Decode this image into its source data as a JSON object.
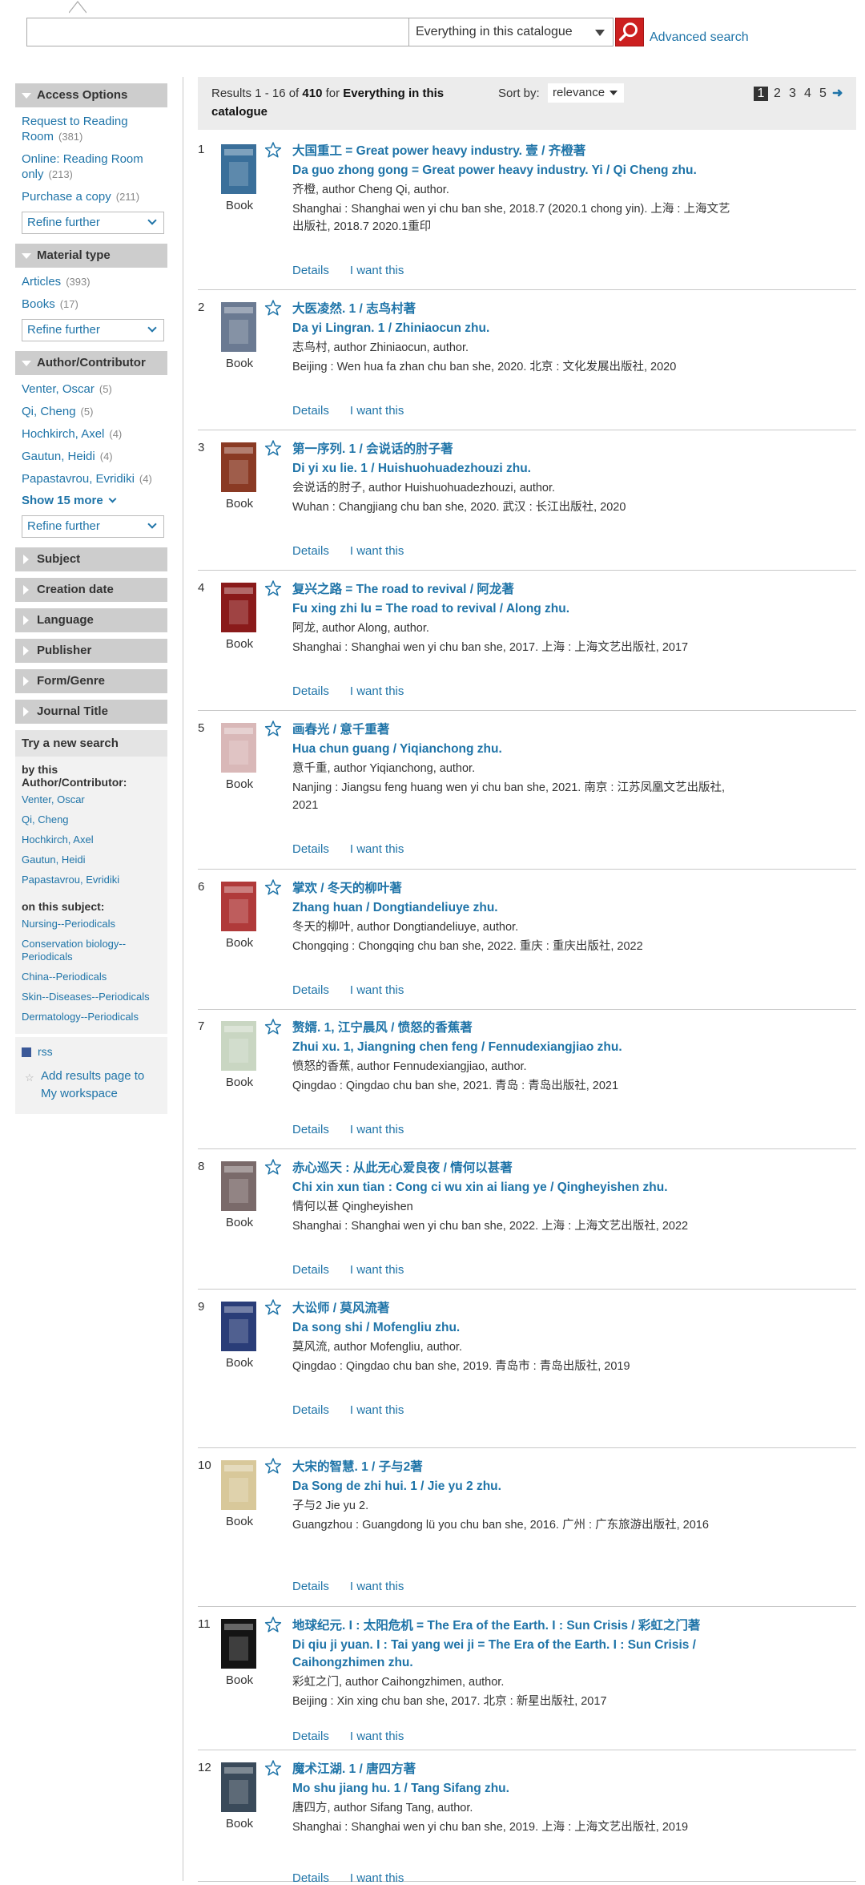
{
  "search": {
    "scope": "Everything in this catalogue",
    "advanced": "Advanced search"
  },
  "sidebar": {
    "access": {
      "title": "Access Options",
      "items": [
        {
          "label": "Request to Reading Room",
          "count": "(381)"
        },
        {
          "label": "Online: Reading Room only",
          "count": "(213)"
        },
        {
          "label": "Purchase a copy",
          "count": "(211)"
        }
      ],
      "refine": "Refine further"
    },
    "material": {
      "title": "Material type",
      "items": [
        {
          "label": "Articles",
          "count": "(393)"
        },
        {
          "label": "Books",
          "count": "(17)"
        }
      ],
      "refine": "Refine further"
    },
    "author": {
      "title": "Author/Contributor",
      "items": [
        {
          "label": "Venter, Oscar",
          "count": "(5)"
        },
        {
          "label": "Qi, Cheng",
          "count": "(5)"
        },
        {
          "label": "Hochkirch, Axel",
          "count": "(4)"
        },
        {
          "label": "Gautun, Heidi",
          "count": "(4)"
        },
        {
          "label": "Papastavrou, Evridiki",
          "count": "(4)"
        }
      ],
      "show_more": "Show 15 more",
      "refine": "Refine further"
    },
    "collapsed": [
      "Subject",
      "Creation date",
      "Language",
      "Publisher",
      "Form/Genre",
      "Journal Title"
    ],
    "try_new": {
      "title": "Try a new search",
      "by_author": "by this Author/Contributor:",
      "authors": [
        "Venter, Oscar",
        "Qi, Cheng",
        "Hochkirch, Axel",
        "Gautun, Heidi",
        "Papastavrou, Evridiki"
      ],
      "on_subject": "on this subject:",
      "subjects": [
        "Nursing--Periodicals",
        "Conservation biology--Periodicals",
        "China--Periodicals",
        "Skin--Diseases--Periodicals",
        "Dermatology--Periodicals"
      ]
    },
    "rss": "rss",
    "workspace": "Add results page to My workspace"
  },
  "results_header": {
    "range": "Results 1 - 16 of",
    "total": "410",
    "for": "for",
    "query": "Everything in this",
    "query2": "catalogue",
    "sort_label": "Sort by:",
    "sort_value": "relevance",
    "pages": [
      "1",
      "2",
      "3",
      "4",
      "5"
    ],
    "next": "➜"
  },
  "item_type": "Book",
  "actions": {
    "details": "Details",
    "want": "I want this"
  },
  "results": [
    {
      "num": "1",
      "t1": "大国重工 = Great power heavy industry. 壹 / 齐橙著",
      "t2": "Da guo zhong gong = Great power heavy industry. Yi / Qi Cheng zhu.",
      "author": "齐橙, author Cheng Qi, author.",
      "pub": "Shanghai : Shanghai wen yi chu ban she, 2018.7 (2020.1 chong yin). 上海 : 上海文艺出版社, 2018.7 2020.1重印",
      "color": "#3a6f9a"
    },
    {
      "num": "2",
      "t1": "大医凌然. 1 / 志鸟村著",
      "t2": "Da yi Lingran. 1 / Zhiniaocun zhu.",
      "author": "志鸟村, author Zhiniaocun, author.",
      "pub": "Beijing : Wen hua fa zhan chu ban she, 2020. 北京 : 文化发展出版社, 2020",
      "color": "#6b7a92"
    },
    {
      "num": "3",
      "t1": "第一序列. 1 / 会说话的肘子著",
      "t2": "Di yi xu lie. 1 / Huishuohuadezhouzi zhu.",
      "author": "会说话的肘子, author Huishuohuadezhouzi, author.",
      "pub": "Wuhan : Changjiang chu ban she, 2020. 武汉 : 长江出版社, 2020",
      "color": "#8a3a24"
    },
    {
      "num": "4",
      "t1": "复兴之路 = The road to revival / 阿龙著",
      "t2": "Fu xing zhi lu = The road to revival / Along zhu.",
      "author": "阿龙, author Along, author.",
      "pub": "Shanghai : Shanghai wen yi chu ban she, 2017. 上海 : 上海文艺出版社, 2017",
      "color": "#8a1a1a"
    },
    {
      "num": "5",
      "t1": "画春光 / 意千重著",
      "t2": "Hua chun guang / Yiqianchong zhu.",
      "author": "意千重, author Yiqianchong, author.",
      "pub": "Nanjing : Jiangsu feng huang wen yi chu ban she, 2021. 南京 : 江苏凤凰文艺出版社, 2021",
      "color": "#d9b8b8"
    },
    {
      "num": "6",
      "t1": "掌欢 / 冬天的柳叶著",
      "t2": "Zhang huan / Dongtiandeliuye zhu.",
      "author": "冬天的柳叶, author Dongtiandeliuye, author.",
      "pub": "Chongqing : Chongqing chu ban she, 2022. 重庆 : 重庆出版社, 2022",
      "color": "#b03a3a"
    },
    {
      "num": "7",
      "t1": "赘婿. 1, 江宁晨风 / 愤怒的香蕉著",
      "t2": "Zhui xu. 1, Jiangning chen feng / Fennudexiangjiao zhu.",
      "author": "愤怒的香蕉, author Fennudexiangjiao, author.",
      "pub": "Qingdao : Qingdao chu ban she, 2021. 青岛 : 青岛出版社, 2021",
      "color": "#c9d6c2"
    },
    {
      "num": "8",
      "t1": "赤心巡天 : 从此无心爱良夜 / 情何以甚著",
      "t2": "Chi xin xun tian : Cong ci wu xin ai liang ye / Qingheyishen zhu.",
      "author": "情何以甚 Qingheyishen",
      "pub": "Shanghai : Shanghai wen yi chu ban she, 2022. 上海 : 上海文艺出版社, 2022",
      "color": "#7a6a6a"
    },
    {
      "num": "9",
      "t1": "大讼师 / 莫风流著",
      "t2": "Da song shi / Mofengliu zhu.",
      "author": "莫风流, author Mofengliu, author.",
      "pub": "Qingdao : Qingdao chu ban she, 2019. 青岛市 : 青岛出版社, 2019",
      "color": "#2a3d78"
    },
    {
      "num": "10",
      "t1": "大宋的智慧. 1 / 子与2著",
      "t2": "Da Song de zhi hui. 1 / Jie yu 2 zhu.",
      "author": "子与2 Jie yu 2.",
      "pub": "Guangzhou : Guangdong lü you chu ban she, 2016. 广州 : 广东旅游出版社, 2016",
      "color": "#d8c89a"
    },
    {
      "num": "11",
      "t1": "地球纪元. I : 太阳危机 = The Era of the Earth. I : Sun Crisis / 彩虹之门著",
      "t2": "Di qiu ji yuan. I : Tai yang wei ji = The Era of the Earth. I : Sun Crisis / Caihongzhimen zhu.",
      "author": "彩虹之门, author Caihongzhimen, author.",
      "pub": "Beijing : Xin xing chu ban she, 2017. 北京 : 新星出版社, 2017",
      "color": "#141414"
    },
    {
      "num": "12",
      "t1": "魔术江湖. 1 / 唐四方著",
      "t2": "Mo shu jiang hu. 1 / Tang Sifang zhu.",
      "author": "唐四方, author Sifang Tang, author.",
      "pub": "Shanghai : Shanghai wen yi chu ban she, 2019. 上海 : 上海文艺出版社, 2019",
      "color": "#3a4a5a"
    }
  ]
}
